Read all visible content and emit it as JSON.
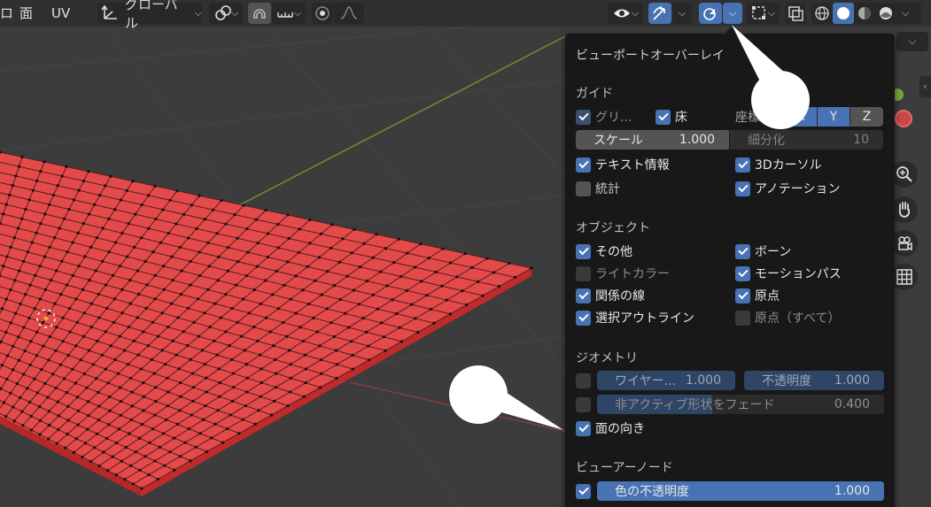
{
  "header": {
    "menu_face": "面",
    "menu_uv": "UV",
    "transform_orientation": "グローバル",
    "left_edge_glyph": "ロ"
  },
  "icons": {
    "orientation": "axes-icon",
    "pivot": "pivot-icon",
    "snap": "magnet-icon",
    "proportional": "proportional-icon",
    "visibility": "eye-icon",
    "gizmo": "gizmo-icon",
    "overlay": "overlay-icon",
    "xray": "xray-icon"
  },
  "popover": {
    "title": "ビューポートオーバーレイ",
    "guides": {
      "title": "ガイド",
      "grid": "グリ...",
      "floor": "床",
      "axes_label": "座標軸",
      "axis_x": "X",
      "axis_y": "Y",
      "axis_z": "Z",
      "scale_label": "スケール",
      "scale_value": "1.000",
      "subdiv_label": "細分化",
      "subdiv_value": "10",
      "text_info": "テキスト情報",
      "cursor_3d": "3Dカーソル",
      "stats": "統計",
      "annotations": "アノテーション"
    },
    "objects": {
      "title": "オブジェクト",
      "extras": "その他",
      "bones": "ボーン",
      "light_colors": "ライトカラー",
      "motion_paths": "モーションパス",
      "relationship_lines": "関係の線",
      "origins": "原点",
      "outline_selected": "選択アウトライン",
      "origins_all": "原点（すべて）"
    },
    "geometry": {
      "title": "ジオメトリ",
      "wireframe_label": "ワイヤー...",
      "wireframe_value": "1.000",
      "opacity_label": "不透明度",
      "opacity_value": "1.000",
      "fade_label": "非アクティブ形状をフェード",
      "fade_value": "0.400",
      "face_orientation": "面の向き"
    },
    "viewer_node": {
      "title": "ビューアーノード",
      "color_opacity_label": "色の不透明度",
      "color_opacity_value": "1.000"
    }
  },
  "states": {
    "grid": true,
    "floor": true,
    "text_info": true,
    "cursor_3d": true,
    "stats": false,
    "annotations": true,
    "extras": true,
    "bones": true,
    "light_colors": false,
    "motion_paths": true,
    "relationship_lines": true,
    "origins": true,
    "outline_selected": true,
    "origins_all": false,
    "wireframe": false,
    "fade": false,
    "face_orientation": true,
    "viewer_node": true,
    "axis_x": true,
    "axis_y": true,
    "axis_z": false
  },
  "levels": {
    "scale_fraction": 0.5,
    "color_opacity_fraction": 1.0,
    "wireframe_fraction": 1.0,
    "opacity_fraction": 1.0,
    "fade_fraction": 0.4
  },
  "colors": {
    "accent": "#4772b3",
    "mesh_face": "#e34a4a",
    "floor_bg": "#3c3c3c",
    "popover_bg": "#181818"
  }
}
